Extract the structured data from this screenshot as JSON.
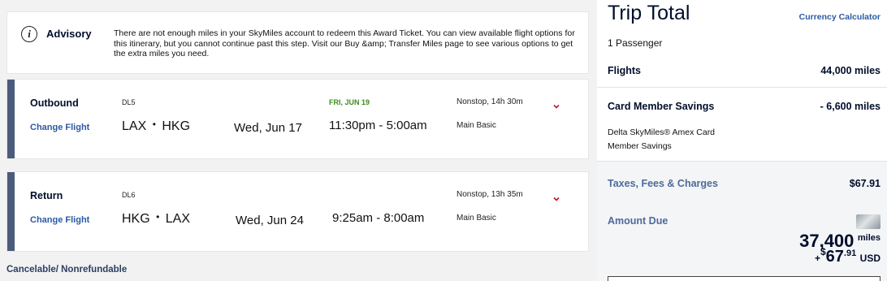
{
  "advisory": {
    "title": "Advisory",
    "text": "There are not enough miles in your SkyMiles account to redeem this Award Ticket. You can view available flight options for this itinerary, but you cannot continue past this step. Visit our Buy &amp; Transfer Miles page to see various options to get the extra miles you need."
  },
  "outbound": {
    "direction": "Outbound",
    "change_label": "Change Flight",
    "flight_number": "DL5",
    "route_from": "LAX",
    "route_to": "HKG",
    "date": "Wed, Jun 17",
    "arrival_date": "FRI, JUN 19",
    "times": "11:30pm - 5:00am",
    "stops_duration": "Nonstop, 14h 30m",
    "cabin": "Main Basic"
  },
  "return": {
    "direction": "Return",
    "change_label": "Change Flight",
    "flight_number": "DL6",
    "route_from": "HKG",
    "route_to": "LAX",
    "date": "Wed, Jun 24",
    "times": "9:25am - 8:00am",
    "stops_duration": "Nonstop, 13h 35m",
    "cabin": "Main Basic"
  },
  "cancel_policy": "Cancelable/ Nonrefundable",
  "trip_total": {
    "title": "Trip Total",
    "currency_link": "Currency Calculator",
    "passengers": "1 Passenger",
    "flights_label": "Flights",
    "flights_value": "44,000 miles",
    "savings_label": "Card Member Savings",
    "savings_value": "- 6,600 miles",
    "savings_desc_line1": "Delta SkyMiles® Amex Card",
    "savings_desc_line2": "Member Savings",
    "taxes_label": "Taxes, Fees & Charges",
    "taxes_value": "$67.91",
    "amount_due_label": "Amount Due",
    "amount_miles": "37,400",
    "amount_miles_unit": "miles",
    "amount_plus": "+",
    "amount_currency_symbol": "$",
    "amount_usd_whole": "67",
    "amount_usd_cents": ".91",
    "amount_usd_unit": "USD"
  },
  "colors": {
    "accent_blue": "#2c5aa6",
    "navy": "#000d2b",
    "arrival_green": "#3d8b1f",
    "chevron_red": "#c8102e",
    "card_bar": "#4a5b7c"
  },
  "icons": {
    "advisory": "info-icon",
    "expand": "chevron-down-icon",
    "card": "credit-card-icon"
  }
}
